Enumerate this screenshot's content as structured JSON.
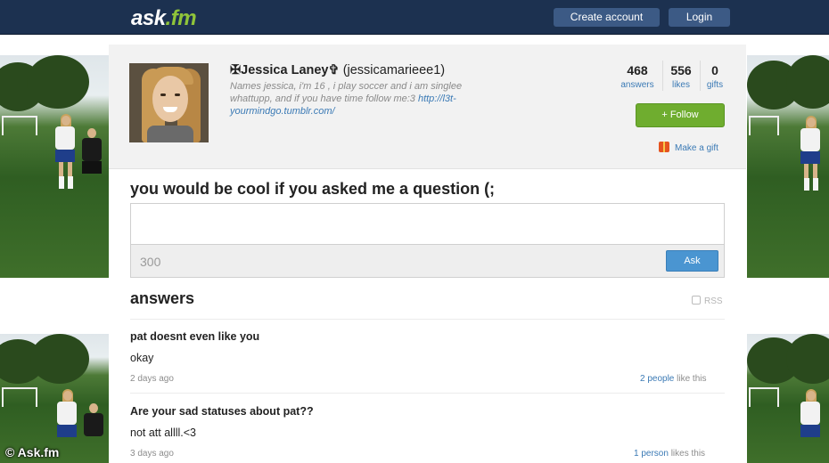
{
  "header": {
    "logo": {
      "ask": "ask",
      "dot": ".",
      "fm": "fm"
    },
    "create_account": "Create account",
    "login": "Login"
  },
  "profile": {
    "display_name": "✠Jessica Laney✞",
    "username": "(jessicamarieee1)",
    "bio": "Names jessica, i'm 16 , i play soccer and i am singlee whattupp, and if you have time follow me:3 ",
    "bio_link": "http://l3t-yourmindgo.tumblr.com/",
    "stats": {
      "answers": {
        "value": "468",
        "label": "answers"
      },
      "likes": {
        "value": "556",
        "label": "likes"
      },
      "gifts": {
        "value": "0",
        "label": "gifts"
      }
    },
    "follow_label": "+ Follow",
    "gift_label": "Make a gift"
  },
  "ask": {
    "prompt": "you would be cool if you asked me a question (;",
    "char_count": "300",
    "button": "Ask"
  },
  "answers": {
    "heading": "answers",
    "rss": "RSS",
    "items": [
      {
        "question": "pat doesnt even like you",
        "answer": "okay",
        "time": "2 days ago",
        "likes_link": "2 people",
        "likes_suffix": " like this"
      },
      {
        "question": "Are your sad statuses about pat??",
        "answer": "not att allll.<3",
        "time": "3 days ago",
        "likes_link": "1 person",
        "likes_suffix": " likes this"
      }
    ]
  },
  "watermark": "© Ask.fm",
  "colors": {
    "topbar": "#1c3150",
    "brand_green": "#8fc43a",
    "follow_green": "#6fad2f",
    "link_blue": "#3b7ab5",
    "ask_button": "#4a95d1"
  }
}
